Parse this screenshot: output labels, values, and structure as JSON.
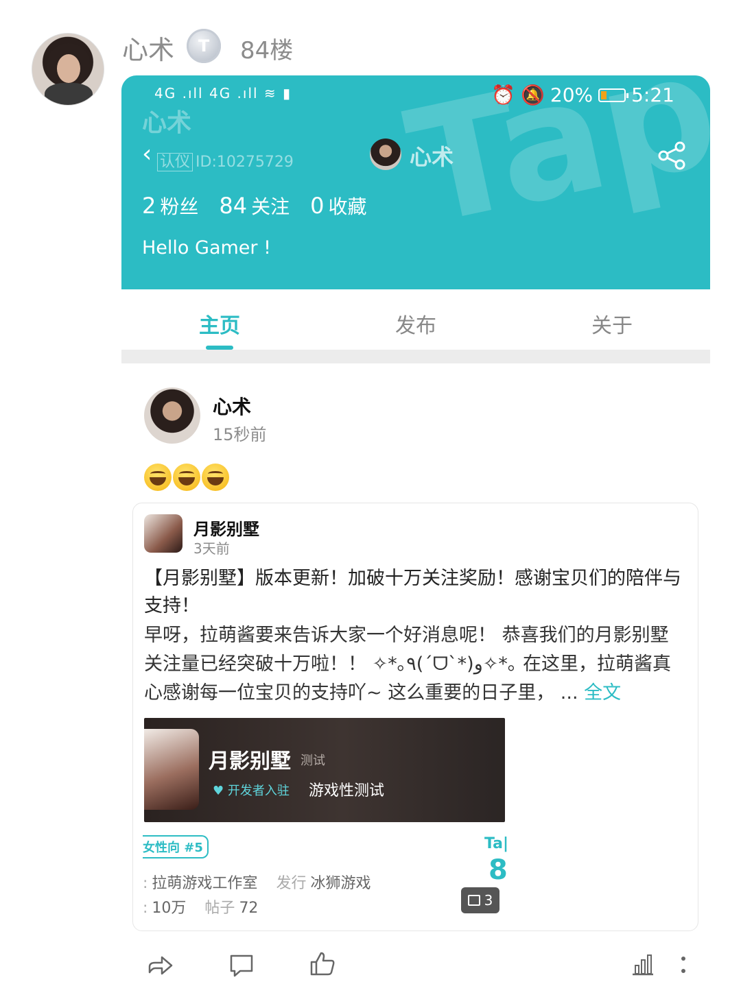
{
  "floor": {
    "username": "心术",
    "badge": "T",
    "floor_label": "84楼"
  },
  "profile": {
    "status_left": "4G .ıll 4G .ıll ≋ ▮",
    "status_right": {
      "battery": "20%",
      "time": "5:21"
    },
    "ghost_name": "心术",
    "back_icon": "‹",
    "id_tag": "认仪",
    "id_text": "ID:10275729",
    "title_name": "心术",
    "stats": [
      {
        "value": "2",
        "label": "粉丝"
      },
      {
        "value": "84",
        "label": "关注"
      },
      {
        "value": "0",
        "label": "收藏"
      }
    ],
    "bio": "Hello Gamer !",
    "accent": "#2cbcc4"
  },
  "tabs": [
    "主页",
    "发布",
    "关于"
  ],
  "post": {
    "author": "心术",
    "time": "15秒前",
    "emoji_count": 3
  },
  "repost": {
    "name": "月影别墅",
    "time": "3天前",
    "title": "【月影别墅】版本更新！加破十万关注奖励！感谢宝贝们的陪伴与支持！",
    "body": "早呀，拉萌酱要来告诉大家一个好消息呢！ 恭喜我们的月影别墅关注量已经突破十万啦！！ ✧*｡٩(ˊᗜˋ*)و✧*｡ 在这里，拉萌酱真心感谢每一位宝贝的支持吖~ 这么重要的日子里， ...",
    "more": "全文",
    "game": {
      "name": "月影别墅",
      "status": "测试",
      "dev_badge": "开发者入驻",
      "type": "游戏性测试",
      "rank": "女性向 #5",
      "rating_brand": "Ta|",
      "rating": "8",
      "studio": "拉萌游戏工作室",
      "publisher_label": "发行",
      "publisher": "冰狮游戏",
      "followers": "10万",
      "posts_label": "帖子",
      "posts": "72",
      "image_count": "3"
    }
  }
}
